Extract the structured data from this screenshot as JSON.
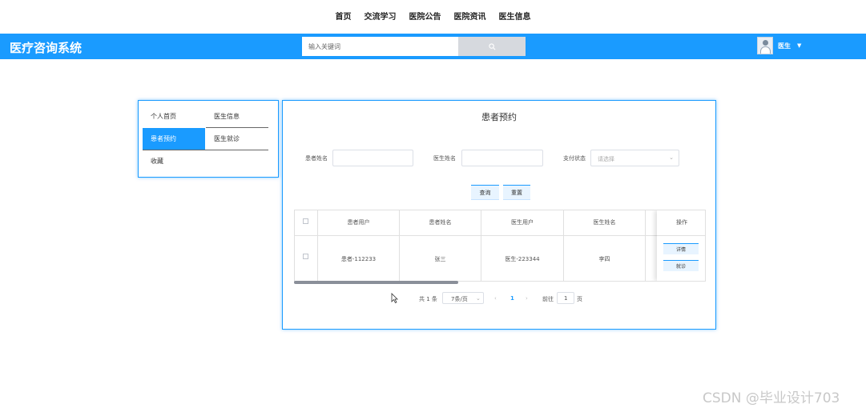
{
  "nav": {
    "items": [
      "首页",
      "交流学习",
      "医院公告",
      "医院资讯",
      "医生信息"
    ]
  },
  "header": {
    "brand": "医疗咨询系统",
    "search_placeholder": "输入关键词",
    "user_name": "医生",
    "accent_color": "#1a9bff"
  },
  "sidebar": {
    "items": [
      {
        "label": "个人首页",
        "active": false
      },
      {
        "label": "医生信息",
        "active": false
      },
      {
        "label": "患者预约",
        "active": true
      },
      {
        "label": "医生就诊",
        "active": false
      },
      {
        "label": "收藏",
        "active": false
      }
    ]
  },
  "main": {
    "title": "患者预约",
    "filters": {
      "patient_name_label": "患者姓名",
      "doctor_name_label": "医生姓名",
      "pay_status_label": "支付状态",
      "pay_status_placeholder": "请选择"
    },
    "buttons": {
      "query": "查询",
      "reset": "重置"
    },
    "table": {
      "columns": [
        "患者用户",
        "患者姓名",
        "医生用户",
        "医生姓名",
        "操作"
      ],
      "rows": [
        {
          "patient_user": "患者-112233",
          "patient_name": "张三",
          "doctor_user": "医生-223344",
          "doctor_name": "李四"
        }
      ],
      "row_actions": [
        "详情",
        "就诊"
      ]
    },
    "pagination": {
      "total": "共 1 条",
      "page_size": "7条/页",
      "prev": "‹",
      "current": "1",
      "next": "›",
      "goto_prefix": "前往",
      "goto_value": "1",
      "goto_suffix": "页"
    }
  },
  "watermark": "CSDN @毕业设计703"
}
